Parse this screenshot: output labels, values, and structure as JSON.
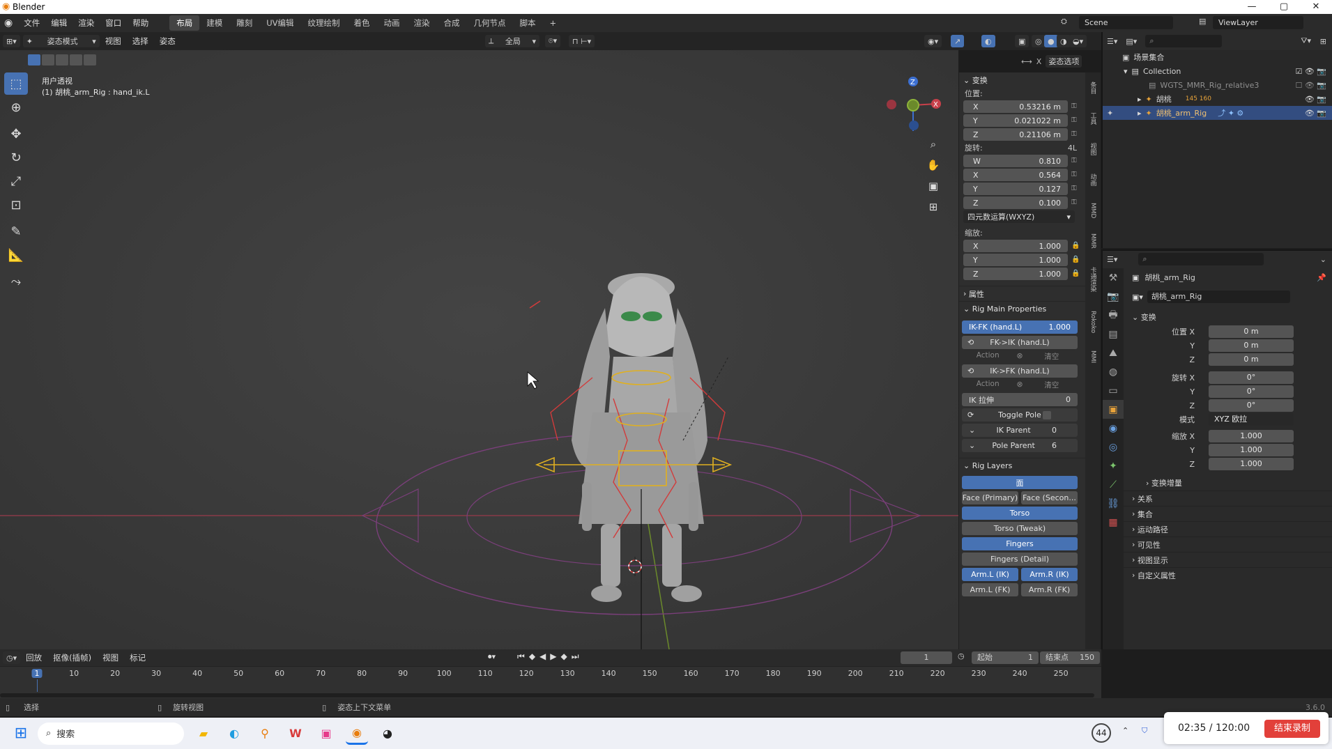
{
  "window": {
    "title": "Blender",
    "min_icon": "minimize-icon",
    "max_icon": "maximize-icon",
    "close_icon": "close-icon"
  },
  "menubar": {
    "menus": [
      "文件",
      "编辑",
      "渲染",
      "窗口",
      "帮助"
    ],
    "workspaces": [
      "布局",
      "建模",
      "雕刻",
      "UV编辑",
      "纹理绘制",
      "着色",
      "动画",
      "渲染",
      "合成",
      "几何节点",
      "脚本"
    ],
    "active_workspace": "布局",
    "scene": "Scene",
    "view_layer": "ViewLayer"
  },
  "viewport_header": {
    "mode": "姿态模式",
    "menus": [
      "视图",
      "选择",
      "姿态"
    ],
    "transform_orientation": "全局",
    "pose_options": "姿态选项"
  },
  "viewport": {
    "view_name": "用户透视",
    "object_info": "(1) 胡桃_arm_Rig : hand_ik.L"
  },
  "npanel": {
    "transform_header": "变换",
    "location_label": "位置:",
    "location": [
      {
        "axis": "X",
        "value": "0.53216 m"
      },
      {
        "axis": "Y",
        "value": "0.021022 m"
      },
      {
        "axis": "Z",
        "value": "0.21106 m"
      }
    ],
    "rotation_label": "旋转:",
    "rotation_mode_badge": "4L",
    "rotation": [
      {
        "axis": "W",
        "value": "0.810"
      },
      {
        "axis": "X",
        "value": "0.564"
      },
      {
        "axis": "Y",
        "value": "0.127"
      },
      {
        "axis": "Z",
        "value": "0.100"
      }
    ],
    "rotation_mode": "四元数运算(WXYZ)",
    "scale_label": "缩放:",
    "scale": [
      {
        "axis": "X",
        "value": "1.000"
      },
      {
        "axis": "Y",
        "value": "1.000"
      },
      {
        "axis": "Z",
        "value": "1.000"
      }
    ],
    "properties_header": "属性",
    "rig_main_header": "Rig Main Properties",
    "ikfk_label": "IK-FK (hand.L)",
    "ikfk_value": "1.000",
    "fk_to_ik": "FK->IK (hand.L)",
    "ik_to_fk": "IK->FK (hand.L)",
    "action_label": "Action",
    "clear_label": "清空",
    "ik_stretch_label": "IK 拉伸",
    "ik_stretch_value": "0",
    "toggle_pole": "Toggle Pole",
    "ik_parent_label": "IK Parent",
    "ik_parent_value": "0",
    "pole_parent_label": "Pole Parent",
    "pole_parent_value": "6",
    "rig_layers_header": "Rig Layers",
    "layers": {
      "face": "面",
      "face_primary": "Face (Primary)",
      "face_secondary": "Face (Secon...",
      "torso": "Torso",
      "torso_tweak": "Torso (Tweak)",
      "fingers": "Fingers",
      "fingers_detail": "Fingers (Detail)",
      "arm_l_ik": "Arm.L (IK)",
      "arm_r_ik": "Arm.R (IK)",
      "arm_l_fk": "Arm.L (FK)",
      "arm_r_fk": "Arm.R (FK)"
    }
  },
  "sidetabs": [
    "条目",
    "工具",
    "视图",
    "动画",
    "MMD",
    "MMR",
    "卡通渲染",
    "Rokoko",
    "MMI"
  ],
  "outliner": {
    "scene_collection": "场景集合",
    "rows": [
      {
        "name": "Collection",
        "indent": 1
      },
      {
        "name": "WGTS_MMR_Rig_relative3",
        "indent": 2
      },
      {
        "name": "胡桃",
        "indent": 2,
        "badges": "145  160"
      },
      {
        "name": "胡桃_arm_Rig",
        "indent": 2,
        "selected": true
      }
    ]
  },
  "properties": {
    "object_name": "胡桃_arm_Rig",
    "data_name": "胡桃_arm_Rig",
    "transform_header": "变换",
    "location_label": "位置 X",
    "location": [
      "0 m",
      "0 m",
      "0 m"
    ],
    "rotation_label": "旋转 X",
    "rotation": [
      "0°",
      "0°",
      "0°"
    ],
    "mode_label": "模式",
    "mode_value": "XYZ 欧拉",
    "scale_label": "缩放 X",
    "scale": [
      "1.000",
      "1.000",
      "1.000"
    ],
    "axis_y": "Y",
    "axis_z": "Z",
    "delta_transform": "变换增量",
    "sections": [
      "关系",
      "集合",
      "运动路径",
      "可见性",
      "视图显示",
      "自定义属性"
    ]
  },
  "timeline": {
    "playback": "回放",
    "keying": "抠像(插帧)",
    "view": "视图",
    "marker": "标记",
    "current_frame": "1",
    "start_label": "起始",
    "start_value": "1",
    "end_label": "结束点",
    "end_value": "150",
    "ruler": [
      "1",
      "10",
      "20",
      "30",
      "40",
      "50",
      "60",
      "70",
      "80",
      "90",
      "100",
      "110",
      "120",
      "130",
      "140",
      "150",
      "160",
      "170",
      "180",
      "190",
      "200",
      "210",
      "220",
      "230",
      "240",
      "250"
    ]
  },
  "statusbar": {
    "select": "选择",
    "rotate_view": "旋转视图",
    "context_menu": "姿态上下文菜单",
    "version": "3.6.0"
  },
  "taskbar": {
    "search_placeholder": "搜索",
    "badge": "44"
  },
  "recording": {
    "time": "02:35 / 120:00",
    "stop_label": "结束录制"
  },
  "colors": {
    "accent": "#4772b3",
    "selected_row": "#334d80",
    "record_red": "#e2403a"
  }
}
